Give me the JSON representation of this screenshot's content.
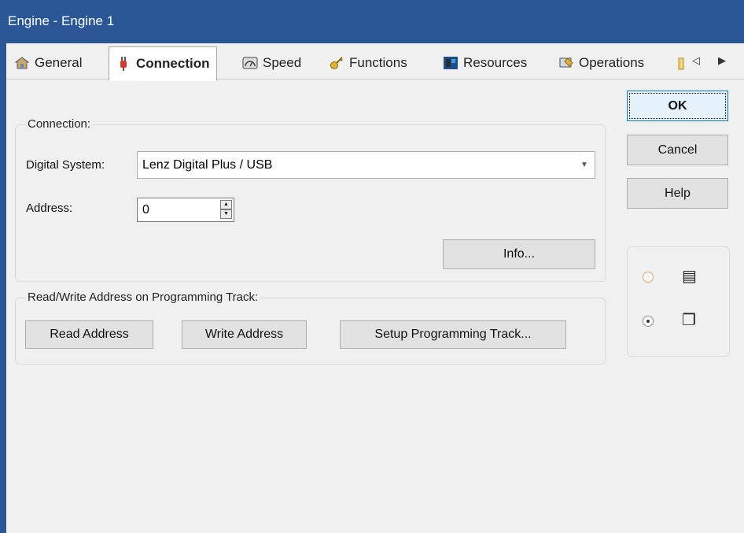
{
  "window": {
    "title": "Engine - Engine 1"
  },
  "tabs": [
    {
      "label": "General",
      "icon": "general-icon"
    },
    {
      "label": "Connection",
      "icon": "connection-plug-icon",
      "active": true
    },
    {
      "label": "Speed",
      "icon": "speedometer-icon"
    },
    {
      "label": "Functions",
      "icon": "functions-key-icon"
    },
    {
      "label": "Resources",
      "icon": "resources-icon"
    },
    {
      "label": "Operations",
      "icon": "operations-icon"
    }
  ],
  "connection": {
    "group_title": "Connection:",
    "digital_system_label": "Digital System:",
    "digital_system_value": "Lenz Digital Plus / USB",
    "address_label": "Address:",
    "address_value": "0",
    "info_button": "Info..."
  },
  "programming": {
    "group_title": "Read/Write Address on Programming Track:",
    "read_button": "Read Address",
    "write_button": "Write Address",
    "setup_button": "Setup Programming Track..."
  },
  "buttons": {
    "ok": "OK",
    "cancel": "Cancel",
    "help": "Help"
  },
  "view_options": [
    {
      "icon": "list-view-icon",
      "selected": false
    },
    {
      "icon": "tile-view-icon",
      "selected": true
    }
  ]
}
